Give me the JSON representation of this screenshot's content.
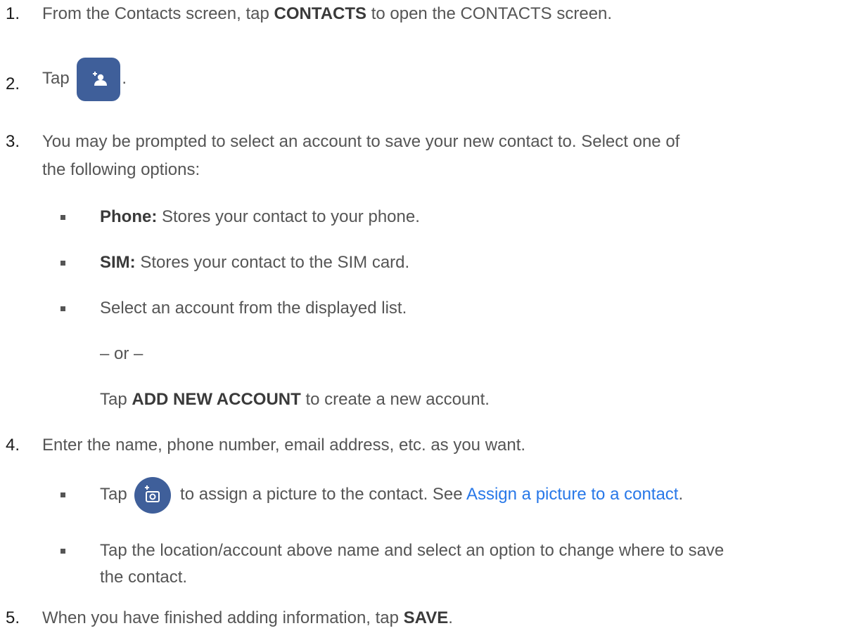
{
  "steps": [
    {
      "number": "1.",
      "pre": "From the Contacts screen, tap ",
      "bold": "CONTACTS",
      "post": " to open the CONTACTS screen."
    },
    {
      "number": "2.",
      "pre": "Tap ",
      "icon": "add-contact-icon",
      "post": "."
    },
    {
      "number": "3.",
      "line1": "You may be prompted to select an account to save your new contact to. Select one of",
      "line2": "the following options:",
      "options": [
        {
          "bold": "Phone:",
          "text": " Stores your contact to your phone."
        },
        {
          "bold": "SIM:",
          "text": " Stores your contact to the SIM card."
        },
        {
          "text": "Select an account from the displayed list."
        }
      ],
      "or": "– or –",
      "alt_pre": "Tap ",
      "alt_bold": "ADD NEW ACCOUNT",
      "alt_post": " to create a new account."
    },
    {
      "number": "4.",
      "text": "Enter the name, phone number, email address, etc. as you want.",
      "bullets": [
        {
          "pre": "Tap ",
          "icon": "add-photo-icon",
          "mid": " to assign a picture to the contact. See ",
          "link": "Assign a picture to a contact",
          "post": "."
        },
        {
          "line1": "Tap the location/account above name and select an option to change where to save",
          "line2": "the contact."
        }
      ]
    },
    {
      "number": "5.",
      "pre": "When you have finished adding information, tap ",
      "bold": "SAVE",
      "post": "."
    }
  ],
  "colors": {
    "body_text": "#555555",
    "link": "#2878e8",
    "icon_background": "#3f5f9a"
  }
}
